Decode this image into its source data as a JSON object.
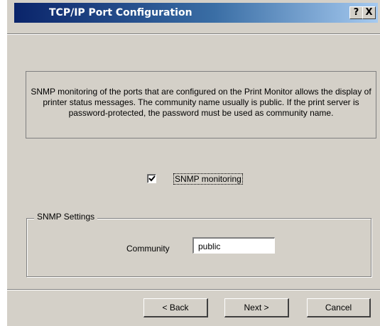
{
  "window": {
    "title": "TCP/IP Port Configuration",
    "help_button": "?",
    "close_button": "X"
  },
  "info_text": "SNMP monitoring of the ports that are configured on the Print Monitor allows the display of printer status messages. The community name usually is public. If the print server is password-protected, the password must be used as community name.",
  "snmp_checkbox": {
    "label": "SNMP monitoring",
    "checked": true
  },
  "snmp_settings": {
    "legend": "SNMP Settings",
    "community_label": "Community",
    "community_value": "public"
  },
  "buttons": {
    "back": "< Back",
    "next": "Next >",
    "cancel": "Cancel"
  }
}
